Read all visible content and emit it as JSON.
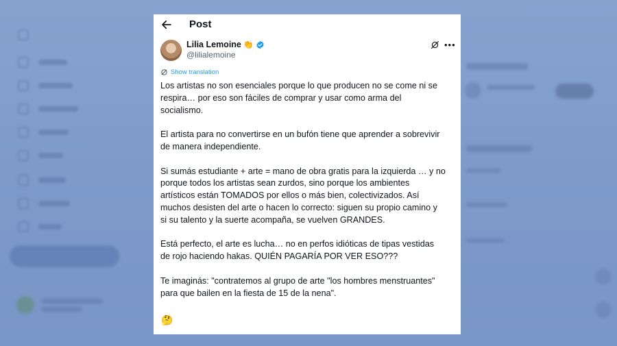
{
  "header": {
    "title": "Post"
  },
  "post": {
    "display_name": "Lilia Lemoine",
    "name_emoji": "👏",
    "handle": "@lilialemoine",
    "show_translation": "Show translation",
    "paragraphs": [
      "Los artistas no son esenciales porque lo que producen no se come ni se\nrespira… por eso son fáciles de comprar y usar como arma del\nsocialismo.",
      "El artista para no convertirse en un bufón tiene que aprender a sobrevivir\nde manera independiente.",
      "Si sumás estudiante + arte = mano de obra gratis para la izquierda … y no\nporque todos los artistas sean zurdos, sino porque los ambientes\nartísticos están TOMADOS por ellos o más bien, colectivizados. Así\nmuchos desisten del arte o hacen lo correcto: siguen su propio camino y\nsi su talento y la suerte  acompaña, se vuelven GRANDES.",
      "Está perfecto, el arte es lucha… no en perfos idióticas de tipas vestidas\nde rojo haciendo hakas. QUIÉN PAGARÍA POR VER ESO???",
      "Te imaginás: \"contratemos al grupo de arte \"los hombres menstruantes\"\npara que bailen en la fiesta de 15 de la nena\"."
    ],
    "closing_emoji": "🤔"
  },
  "icons": {
    "back": "arrow-left-icon",
    "verified": "verified-badge-icon",
    "grok": "grok-icon",
    "more": "more-icon",
    "translate": "translate-icon"
  },
  "colors": {
    "background": "#7e9ccc",
    "accent": "#1d9bf0",
    "text": "#0f1419",
    "secondary_text": "#536471"
  }
}
